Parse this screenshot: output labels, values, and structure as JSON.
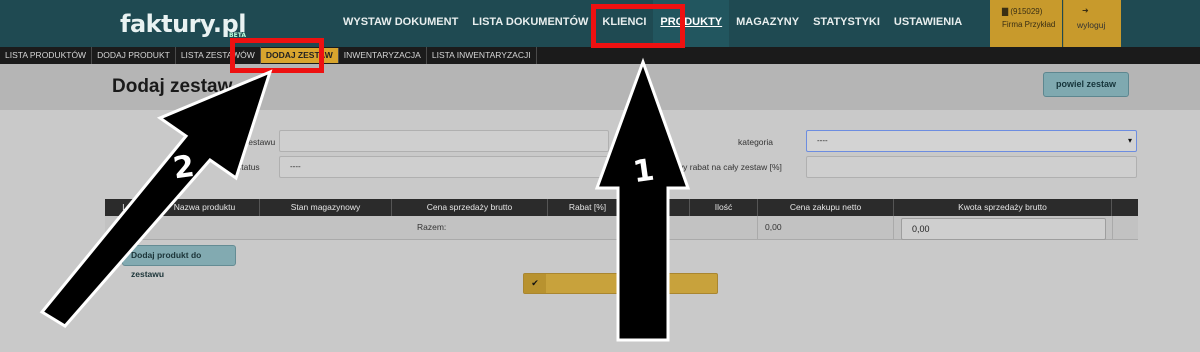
{
  "app": {
    "logo": "faktury.pl",
    "logo_badge": "BETA"
  },
  "nav": {
    "items": [
      "WYSTAW DOKUMENT",
      "LISTA DOKUMENTÓW",
      "KLIENCI",
      "PRODUKTY",
      "MAGAZYNY",
      "STATYSTYKI",
      "USTAWIENIA"
    ],
    "active": "PRODUKTY"
  },
  "account": {
    "number": "(915029)",
    "company": "Firma Przykład",
    "logout": "wyloguj"
  },
  "subnav": {
    "items": [
      "LISTA PRODUKTÓW",
      "DODAJ PRODUKT",
      "LISTA ZESTAWÓW",
      "DODAJ ZESTAW",
      "INWENTARYZACJA",
      "LISTA INWENTARYZACJI"
    ],
    "active": "DODAJ ZESTAW"
  },
  "page": {
    "title": "Dodaj zestaw",
    "duplicate_button": "powiel zestaw"
  },
  "form": {
    "name_label": "zestawu",
    "status_label": "status",
    "status_value": "----",
    "category_label": "kategoria",
    "category_value": "----",
    "discount_label": "wy rabat na cały zestaw [%]",
    "name_value": "",
    "discount_value": ""
  },
  "table": {
    "headers": [
      "Lp",
      "Nazwa produktu",
      "Stan magazynowy",
      "Cena sprzedaży brutto",
      "Rabat [%]",
      "azyn",
      "Ilość",
      "Cena zakupu netto",
      "Kwota sprzedaży brutto"
    ],
    "summary_label": "Razem:",
    "net_total": "0,00",
    "gross_total": "0,00"
  },
  "buttons": {
    "add_product": "Dodaj produkt do zestawu",
    "save_icon": "check-icon"
  },
  "annotations": {
    "step1": "1",
    "step2": "2",
    "highlight_color": "#ee1111",
    "arrow_color": "#000000"
  }
}
